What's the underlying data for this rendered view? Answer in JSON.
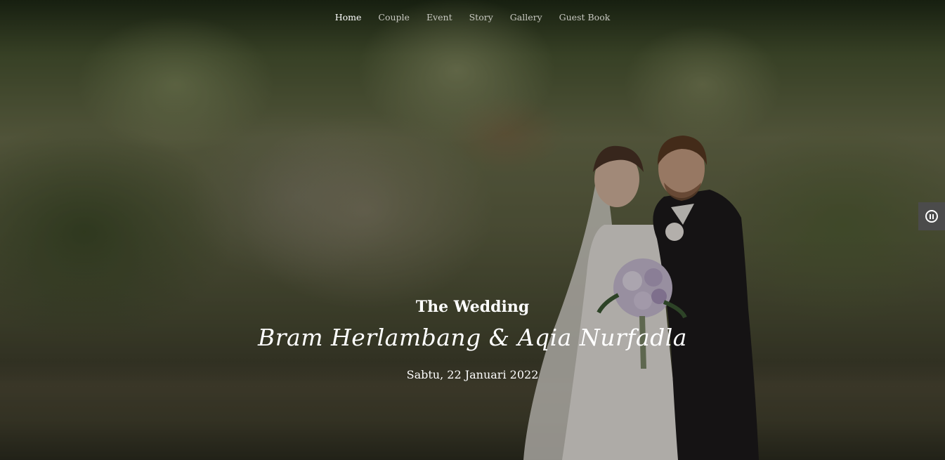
{
  "nav": {
    "items": [
      {
        "label": "Home",
        "active": true
      },
      {
        "label": "Couple",
        "active": false
      },
      {
        "label": "Event",
        "active": false
      },
      {
        "label": "Story",
        "active": false
      },
      {
        "label": "Gallery",
        "active": false
      },
      {
        "label": "Guest Book",
        "active": false
      }
    ]
  },
  "hero": {
    "heading": "The Wedding",
    "names": "Bram Herlambang & Aqia Nurfadla",
    "date": "Sabtu, 22 Januari 2022"
  },
  "music_control": {
    "icon": "pause-icon"
  },
  "colors": {
    "nav_active": "#ffffff",
    "nav_inactive": "#c9c9c2",
    "music_button_bg": "#4b4b4b"
  }
}
